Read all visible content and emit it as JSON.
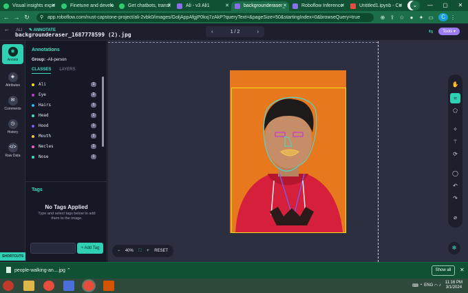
{
  "browser": {
    "tabs": [
      {
        "title": "Visual insights expe",
        "active": false,
        "icon": "green-dot"
      },
      {
        "title": "Finetune and develo",
        "active": false,
        "icon": "green-dot"
      },
      {
        "title": "Get chatbots, transl",
        "active": false,
        "icon": "green-dot"
      },
      {
        "title": "Ali - v3 Ali1",
        "active": false,
        "icon": "roboflow"
      },
      {
        "title": "backgrounderaser_",
        "active": true,
        "icon": "roboflow"
      },
      {
        "title": "Roboflow Inference",
        "active": false,
        "icon": "roboflow"
      },
      {
        "title": "Untitled1.ipynb - Co",
        "active": false,
        "icon": "colab"
      }
    ],
    "new_tab": "+",
    "url": "app.roboflow.com/nust-capstone-project/ali-2vbk0/images/GoljAppAfgjP0kxj7zAkP?queryText=&pageSize=50&startingIndex=0&browseQuery=true",
    "profile_initial": "C"
  },
  "header": {
    "breadcrumb_project": "ALI",
    "breadcrumb_mode": "ANNOTATE",
    "filename": "backgrounderaser_1687778599 (2).jpg",
    "pager": "1 / 2",
    "tools_label": "Tools"
  },
  "rail": {
    "items": [
      {
        "label": "Annots",
        "icon": "annotation-icon",
        "active": true
      },
      {
        "label": "Attributes",
        "icon": "tag-icon",
        "active": false
      },
      {
        "label": "Comments",
        "icon": "comment-icon",
        "active": false
      },
      {
        "label": "History",
        "icon": "history-icon",
        "active": false
      },
      {
        "label": "Raw Data",
        "icon": "code-icon",
        "active": false
      }
    ],
    "shortcuts": "SHORTCUTS"
  },
  "panel": {
    "title": "Annotations",
    "group_label": "Group:",
    "group_value": "-Ali-person",
    "tab_classes": "CLASSES",
    "tab_layers": "LAYERS",
    "classes": [
      {
        "name": "Ali",
        "color": "#f5e21a",
        "count": "1"
      },
      {
        "name": "Eye",
        "color": "#c23ad6",
        "count": "2"
      },
      {
        "name": "Hairs",
        "color": "#2bb8e8",
        "count": "1"
      },
      {
        "name": "Head",
        "color": "#4fd6d0",
        "count": "1"
      },
      {
        "name": "Hood",
        "color": "#7b5cf0",
        "count": "1"
      },
      {
        "name": "Mouth",
        "color": "#f2c94c",
        "count": "1"
      },
      {
        "name": "Necles",
        "color": "#f25cc5",
        "count": "1"
      },
      {
        "name": "Nose",
        "color": "#3fe0c5",
        "count": "1"
      }
    ],
    "tags_title": "Tags",
    "no_tags": "No Tags Applied",
    "no_tags_sub": "Type and select tags below to add them to the image.",
    "add_tag": "+ Add Tag"
  },
  "canvas": {
    "zoom": "40%",
    "reset": "RESET"
  },
  "downloads": {
    "file": "people-walking-an....jpg",
    "show_all": "Show all"
  },
  "taskbar": {
    "lang": "ENG",
    "time": "11:16 PM",
    "date": "3/1/2024"
  }
}
